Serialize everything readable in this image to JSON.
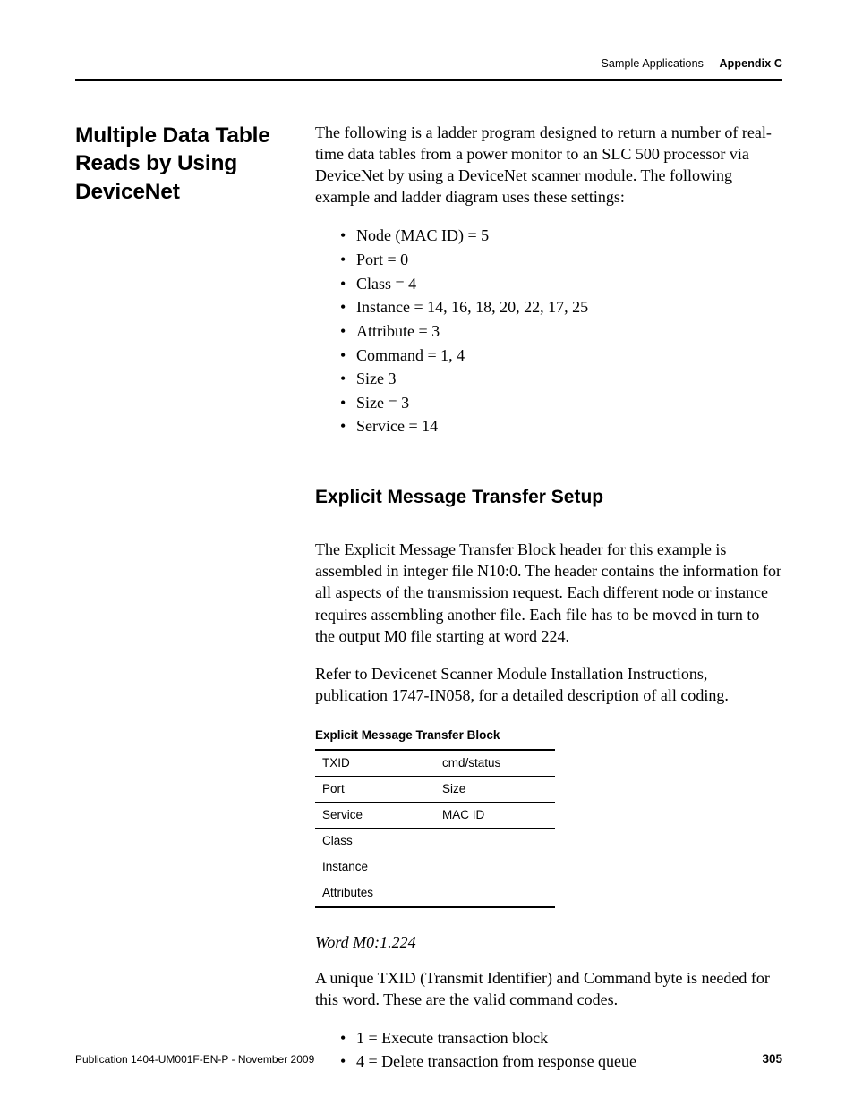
{
  "header": {
    "left": "Sample Applications",
    "right": "Appendix C"
  },
  "sidebar": {
    "title": "Multiple Data Table Reads by Using DeviceNet"
  },
  "intro": "The following is a ladder program designed to return a number of real-time data tables from a power monitor to an SLC 500 processor via DeviceNet by using a DeviceNet scanner module. The following example and ladder diagram uses these settings:",
  "settings": [
    "Node (MAC ID) = 5",
    "Port = 0",
    "Class = 4",
    "Instance = 14, 16, 18, 20, 22, 17, 25",
    "Attribute = 3",
    "Command = 1, 4",
    "Size 3",
    "Size = 3",
    "Service = 14"
  ],
  "sub1": {
    "heading": "Explicit Message Transfer Setup",
    "p1": "The Explicit Message Transfer Block header for this example is assembled in integer file N10:0. The header contains the information for all aspects of the transmission request. Each different node or instance requires assembling another file. Each file has to be moved in turn to the output M0 file starting at word 224.",
    "p2": "Refer to Devicenet Scanner Module Installation Instructions, publication 1747-IN058, for a detailed description of all coding."
  },
  "table": {
    "title": "Explicit Message Transfer Block",
    "rows": [
      {
        "l": "TXID",
        "r": "cmd/status"
      },
      {
        "l": "Port",
        "r": "Size"
      },
      {
        "l": "Service",
        "r": "MAC ID"
      },
      {
        "full": "Class"
      },
      {
        "full": "Instance"
      },
      {
        "full": "Attributes"
      }
    ]
  },
  "word": {
    "heading": "Word M0:1.224",
    "p": "A unique TXID (Transmit Identifier) and Command byte is needed for this word. These are the valid command codes.",
    "codes": [
      "1 = Execute transaction block",
      "4 = Delete transaction from response queue"
    ]
  },
  "footer": {
    "pub": "Publication 1404-UM001F-EN-P - November 2009",
    "page": "305"
  }
}
